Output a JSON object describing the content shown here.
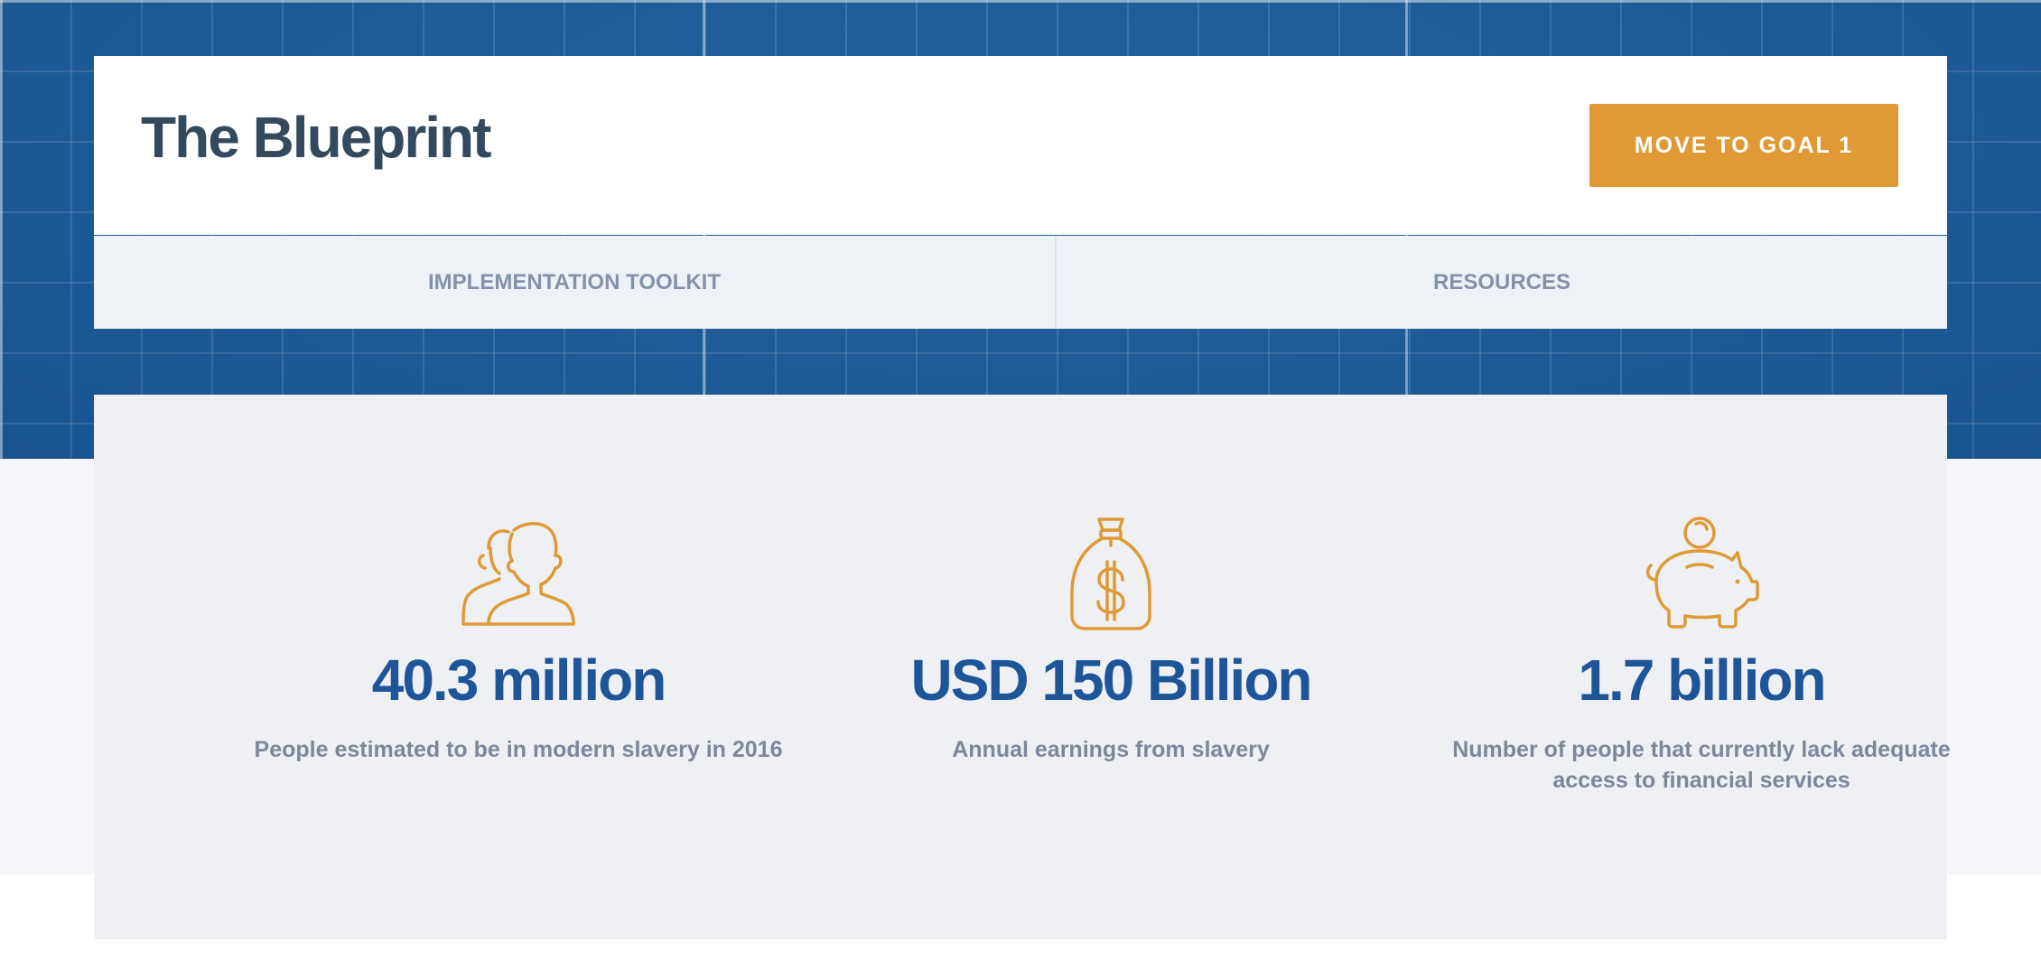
{
  "header": {
    "title": "The Blueprint",
    "goal_button_label": "MOVE TO GOAL 1"
  },
  "nav": {
    "items": [
      {
        "label": "IMPLEMENTATION TOOLKIT"
      },
      {
        "label": "RESOURCES"
      }
    ]
  },
  "stats": [
    {
      "icon": "people-icon",
      "value": "40.3 million",
      "description": "People estimated to be in modern slavery in 2016"
    },
    {
      "icon": "money-bag-icon",
      "value": "USD 150 Billion",
      "description": "Annual earnings from slavery"
    },
    {
      "icon": "piggy-bank-icon",
      "value": "1.7 billion",
      "description": "Number of people that currently lack adequate access to financial services"
    }
  ],
  "colors": {
    "hero_blue": "#1a5c9b",
    "accent_orange": "#df9a35",
    "title_navy": "#34495e",
    "stat_blue": "#1e5599",
    "muted_text": "#7d879a"
  }
}
